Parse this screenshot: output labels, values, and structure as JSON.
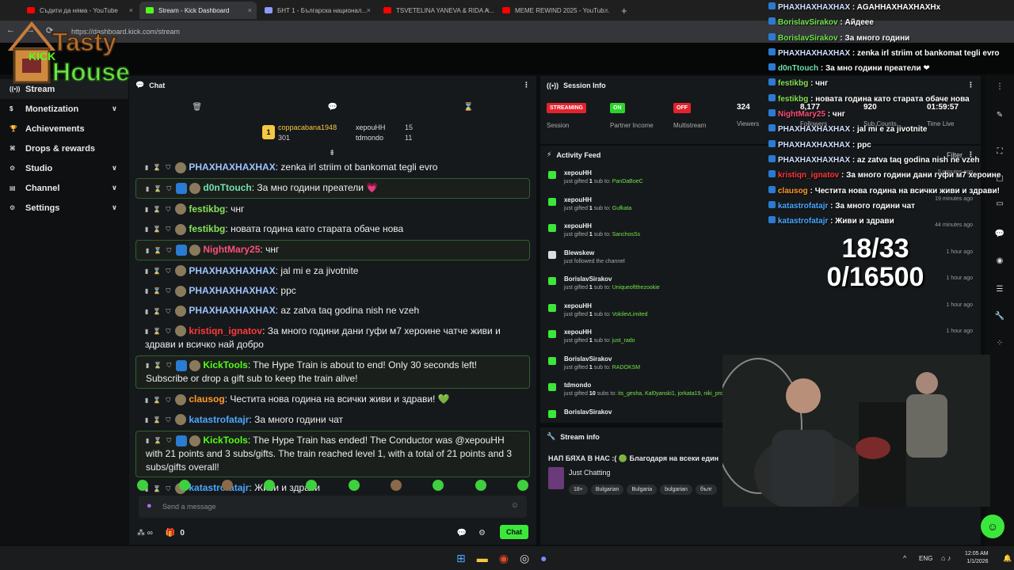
{
  "browser": {
    "tabs": [
      {
        "title": "Съдити да няма - YouTube",
        "color": "#ff0000",
        "active": false
      },
      {
        "title": "Stream - Kick Dashboard",
        "color": "#53fc18",
        "active": true
      },
      {
        "title": "БНТ 1 - Българска национал...",
        "color": "#8a9bff",
        "active": false
      },
      {
        "title": "TSVETELINA YANEVA & RIDA A...",
        "color": "#ff0000",
        "active": false
      },
      {
        "title": "MEME REWIND 2025 - YouTub...",
        "color": "#ff0000",
        "active": false
      }
    ],
    "url": "https://dashboard.kick.com/stream"
  },
  "logo": {
    "line1": "Tasty",
    "line2": "House",
    "kick": "KICK"
  },
  "sidebar": {
    "items": [
      {
        "label": "Stream",
        "icon": "broadcast-icon",
        "active": true,
        "expandable": false
      },
      {
        "label": "Monetization",
        "icon": "dollar-icon",
        "active": false,
        "expandable": true
      },
      {
        "label": "Achievements",
        "icon": "trophy-icon",
        "active": false,
        "expandable": false
      },
      {
        "label": "Drops & rewards",
        "icon": "gift-icon",
        "active": false,
        "expandable": false
      },
      {
        "label": "Studio",
        "icon": "gear-icon",
        "active": false,
        "expandable": true
      },
      {
        "label": "Channel",
        "icon": "monitor-icon",
        "active": false,
        "expandable": true
      },
      {
        "label": "Settings",
        "icon": "gear-icon",
        "active": false,
        "expandable": true
      }
    ]
  },
  "chat": {
    "title": "Chat",
    "leaders": [
      {
        "name": "coppacabana1948",
        "value": "301",
        "color": "#f5c842"
      },
      {
        "name": "хероuHH",
        "value": "15",
        "color": "#ddd"
      },
      {
        "name": "tdmondo",
        "value": "11",
        "color": "#ddd"
      }
    ],
    "messages": [
      {
        "user": "PHAXHAXHAXHAX",
        "color": "#9dc3ff",
        "text": "zenka irl striim ot bankomat tegli evro",
        "hl": false
      },
      {
        "user": "d0nTtouch",
        "color": "#6fe3b0",
        "text": "За мно години преатели 💗",
        "hl": true
      },
      {
        "user": "festikbg",
        "color": "#86e356",
        "text": "чнг",
        "hl": false
      },
      {
        "user": "festikbg",
        "color": "#86e356",
        "text": "новата година като старата обаче нова",
        "hl": false
      },
      {
        "user": "NightMary25",
        "color": "#ff4f7a",
        "text": "чнг",
        "hl": true
      },
      {
        "user": "PHAXHAXHAXHAX",
        "color": "#9dc3ff",
        "text": "jal mi e za jivotnite",
        "hl": false
      },
      {
        "user": "PHAXHAXHAXHAX",
        "color": "#9dc3ff",
        "text": "ppc",
        "hl": false
      },
      {
        "user": "PHAXHAXHAXHAX",
        "color": "#9dc3ff",
        "text": "az zatva taq godina nish ne vzeh",
        "hl": false
      },
      {
        "user": "kristiqn_ignatov",
        "color": "#ff3a3a",
        "text": "За много години дани гуфи м7 хероине чатче живи и здрави и всичко най добро",
        "hl": false
      },
      {
        "user": "KickTools",
        "color": "#53fc18",
        "text": "The Hype Train is about to end! Only 30 seconds left! Subscribe or drop a gift sub to keep the train alive!",
        "hl": true
      },
      {
        "user": "clausog",
        "color": "#ff9a2a",
        "text": "Честита нова година на всички живи и здрави! 💚",
        "hl": false
      },
      {
        "user": "katastrofatajr",
        "color": "#4aa8ff",
        "text": "За много години чат",
        "hl": false
      },
      {
        "user": "KickTools",
        "color": "#53fc18",
        "text": "The Hype Train has ended! The Conductor was @хероuHH with 21 points and 3 subs/gifts. The train reached level 1, with a total of 21 points and 3 subs/gifts overall!",
        "hl": true
      },
      {
        "user": "katastrofatajr",
        "color": "#4aa8ff",
        "text": "Живи и здрави",
        "hl": false
      }
    ],
    "placeholder": "Send a message",
    "count": "0",
    "send_label": "Chat"
  },
  "session": {
    "title": "Session Info",
    "stats": [
      {
        "pill": "STREAMING",
        "pill_color": "#e3232c",
        "label": "Session"
      },
      {
        "pill": "ON",
        "pill_color": "#2bd42b",
        "label": "Partner Income"
      },
      {
        "pill": "OFF",
        "pill_color": "#e3232c",
        "label": "Multistream"
      },
      {
        "value": "324",
        "label": "Viewers"
      },
      {
        "value": "8,177",
        "label": "Followers"
      },
      {
        "value": "920",
        "label": "Sub Counts"
      },
      {
        "value": "01:59:57",
        "label": "Time Live"
      }
    ]
  },
  "activity": {
    "title": "Activity Feed",
    "filter": "Filter",
    "items": [
      {
        "name": "хероuHH",
        "desc": "just gifted",
        "count": "1",
        "mid": "sub to:",
        "target": "PanDaBoeC",
        "time": "5 minutes ago"
      },
      {
        "name": "хероuHH",
        "desc": "just gifted",
        "count": "1",
        "mid": "sub to:",
        "target": "Gufkata",
        "time": "19 minutes ago"
      },
      {
        "name": "хероuHH",
        "desc": "just gifted",
        "count": "1",
        "mid": "sub to:",
        "target": "SanchosSs",
        "time": "44 minutes ago"
      },
      {
        "name": "Blewskew",
        "desc": "just followed the channel",
        "count": "",
        "mid": "",
        "target": "",
        "time": "1 hour ago"
      },
      {
        "name": "BorislavSirakov",
        "desc": "just gifted",
        "count": "1",
        "mid": "sub to:",
        "target": "Uniqueoftthezookie",
        "time": "1 hour ago"
      },
      {
        "name": "хероuHH",
        "desc": "just gifted",
        "count": "1",
        "mid": "sub to:",
        "target": "VokilevLimited",
        "time": "1 hour ago"
      },
      {
        "name": "хероuHH",
        "desc": "just gifted",
        "count": "1",
        "mid": "sub to:",
        "target": "just_rado",
        "time": "1 hour ago"
      },
      {
        "name": "BorislavSirakov",
        "desc": "just gifted",
        "count": "1",
        "mid": "sub to:",
        "target": "RADOKSM",
        "time": "1 hour ago"
      },
      {
        "name": "tdmondo",
        "desc": "just gifted",
        "count": "10",
        "mid": "subs to:",
        "target": "its_gesha, Kal0yanski1, jorkata19, niki_pro10, Aleksande",
        "time": "1 hour ago"
      },
      {
        "name": "BorislavSirakov",
        "desc": "",
        "count": "",
        "mid": "",
        "target": "",
        "time": ""
      }
    ]
  },
  "streaminfo": {
    "title": "Stream info",
    "stream_title": "НАП БЯХА В НАС :( 🟢 Благодаря на всеки един",
    "category": "Just Chatting",
    "tags": [
      "18+",
      "Bulgarian",
      "Bulgaria",
      "bulgarian",
      "бълг"
    ]
  },
  "overlay": {
    "lines": [
      {
        "user": "PHAXHAXHAXHAX",
        "text": "AGAHHAXHAXHAXHx",
        "color": "#cfe0ff"
      },
      {
        "user": "BorislavSirakov",
        "text": "Айдеее",
        "color": "#6fe34a"
      },
      {
        "user": "BorislavSirakov",
        "text": "За много години",
        "color": "#6fe34a"
      },
      {
        "user": "PHAXHAXHAXHAX",
        "text": "zenka irl striim ot bankomat tegli evro",
        "color": "#cfe0ff"
      },
      {
        "user": "d0nTtouch",
        "text": "За мно години преатели ❤",
        "color": "#6fe3b0"
      },
      {
        "user": "festikbg",
        "text": "чнг",
        "color": "#86e356"
      },
      {
        "user": "festikbg",
        "text": "новата година като старата обаче нова",
        "color": "#86e356"
      },
      {
        "user": "NightMary25",
        "text": "чнг",
        "color": "#ff4f7a"
      },
      {
        "user": "PHAXHAXHAXHAX",
        "text": "jal mi e za jivotnite",
        "color": "#cfe0ff"
      },
      {
        "user": "PHAXHAXHAXHAX",
        "text": "ppc",
        "color": "#cfe0ff"
      },
      {
        "user": "PHAXHAXHAXHAX",
        "text": "az zatva taq godina nish ne vzeh",
        "color": "#cfe0ff"
      },
      {
        "user": "kristiqn_ignatov",
        "text": "За много години дани гуфи м7 хероине",
        "color": "#ff3a3a"
      },
      {
        "user": "clausog",
        "text": "Честита нова година на всички живи и здрави!",
        "color": "#ff9a2a"
      },
      {
        "user": "katastrofatajr",
        "text": "За много години чат",
        "color": "#4aa8ff"
      },
      {
        "user": "katastrofatajr",
        "text": "Живи и здрави",
        "color": "#4aa8ff"
      }
    ],
    "counter1": "18/33",
    "counter2": "0/16500"
  },
  "taskbar": {
    "lang": "ENG",
    "time": "12:05 AM",
    "date": "1/1/2026"
  }
}
